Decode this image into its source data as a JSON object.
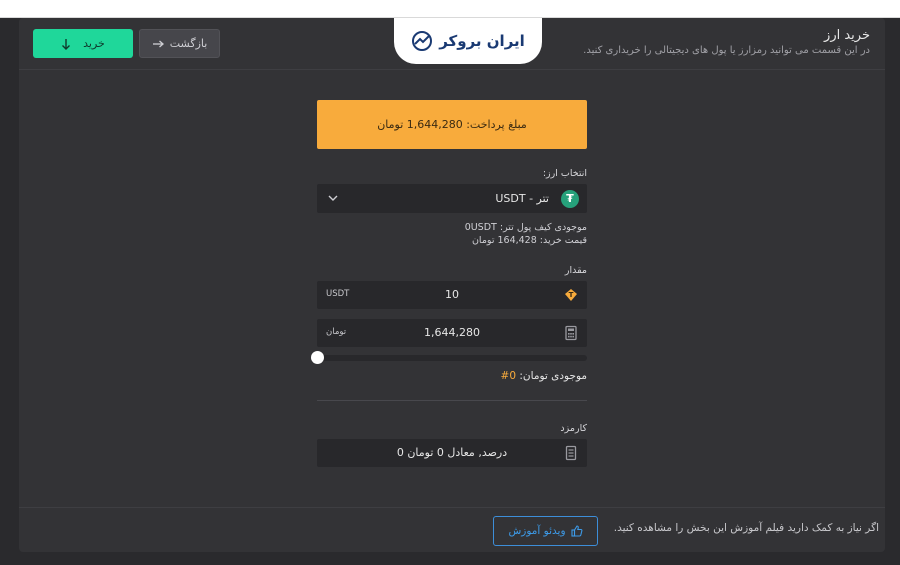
{
  "brand": {
    "logo_text": "ایران بروکر"
  },
  "header": {
    "title": "خرید ارز",
    "subtitle": "در این قسمت می توانید رمزارز یا پول های دیجیتالی را خریداری کنید.",
    "buy_label": "خرید",
    "back_label": "بازگشت"
  },
  "payment": {
    "text": "مبلغ پرداخت: 1,644,280 تومان"
  },
  "currency": {
    "label": "انتخاب ارز:",
    "selected": "تتر - USDT"
  },
  "wallet": {
    "balance_line": "موجودی کیف پول تتر: 0USDT",
    "price_line": "قیمت خرید: 164,428 تومان"
  },
  "amount": {
    "label": "مقدار",
    "usdt_value": "10",
    "usdt_unit": "USDT",
    "toman_value": "1,644,280",
    "toman_unit": "تومان",
    "slider_fraction": 0
  },
  "toman_balance": {
    "label": "موجودی تومان:",
    "value": "0#"
  },
  "fee": {
    "label": "کارمزد",
    "text": "0 درصد, معادل 0 تومان"
  },
  "footer": {
    "help_text": "اگر نیاز به کمک دارید فیلم آموزش این بخش را مشاهده کنید.",
    "video_label": "ویدئو آموزش"
  },
  "colors": {
    "accent_green": "#1fd79a",
    "payment_orange": "#f8ab3c",
    "tether_green": "#26a17b",
    "link_blue": "#3d8ed9"
  }
}
